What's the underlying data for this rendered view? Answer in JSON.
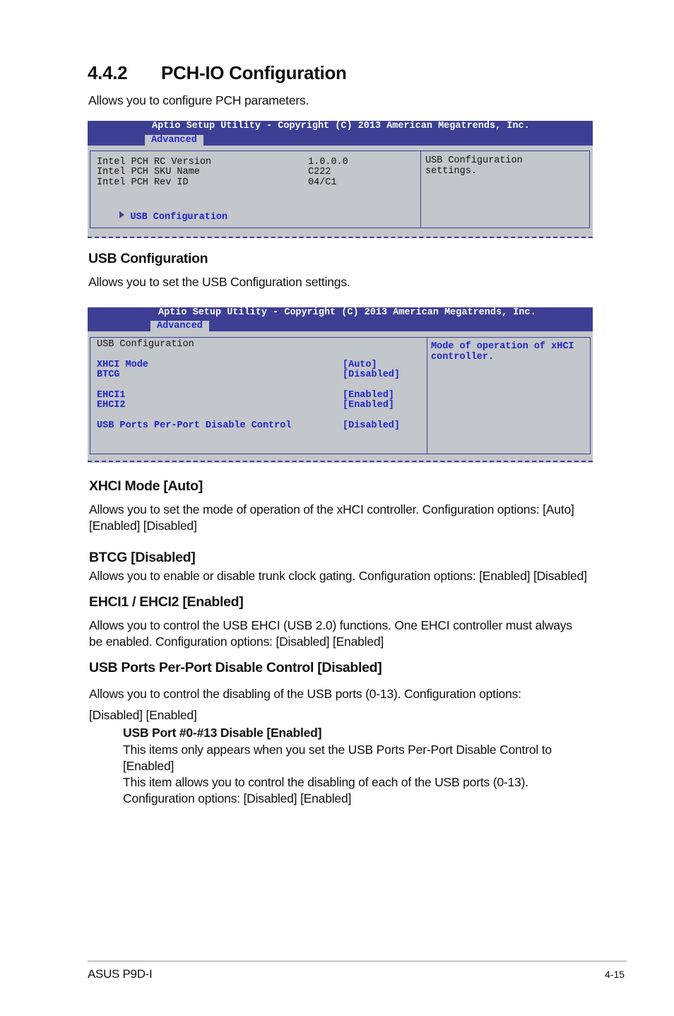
{
  "section": {
    "number": "4.4.2",
    "title": "PCH-IO Configuration",
    "intro": "Allows you to configure PCH parameters."
  },
  "bios1": {
    "title": "Aptio Setup Utility - Copyright (C) 2013 American Megatrends, Inc.",
    "tab": "Advanced",
    "rows": [
      {
        "label": "Intel PCH RC Version",
        "value": "1.0.0.0"
      },
      {
        "label": "Intel PCH SKU Name",
        "value": "C222"
      },
      {
        "label": "Intel PCH Rev ID",
        "value": "04/C1"
      }
    ],
    "submenu": "USB Configuration",
    "help": [
      "USB Configuration",
      "settings."
    ]
  },
  "usb_config": {
    "heading": "USB Configuration",
    "description": "Allows you to set the USB Configuration settings."
  },
  "bios2": {
    "title": "Aptio Setup Utility - Copyright (C) 2013 American Megatrends, Inc.",
    "tab": "Advanced",
    "header": "USB Configuration",
    "items": [
      {
        "label": "XHCI Mode",
        "value": "[Auto]"
      },
      {
        "label": "BTCG",
        "value": "[Disabled]"
      },
      {
        "label": "EHCI1",
        "value": "[Enabled]"
      },
      {
        "label": "EHCI2",
        "value": "[Enabled]"
      },
      {
        "label": "USB Ports Per-Port Disable Control",
        "value": "[Disabled]"
      }
    ],
    "help": [
      "Mode of operation of xHCI",
      "controller."
    ]
  },
  "descriptions": [
    {
      "heading": "XHCI Mode [Auto]",
      "lines": [
        "Allows you to set the mode of operation of the xHCI controller. Configuration options: [Auto]",
        "[Enabled] [Disabled]"
      ]
    },
    {
      "heading": "BTCG [Disabled]",
      "lines": [
        "Allows you to enable or disable trunk clock gating. Configuration options: [Enabled] [Disabled]"
      ]
    },
    {
      "heading": "EHCI1 / EHCI2 [Enabled]",
      "lines": [
        "Allows you to control the USB EHCI (USB 2.0) functions. One EHCI controller must always",
        "be enabled. Configuration options: [Disabled] [Enabled]"
      ]
    },
    {
      "heading": "USB Ports Per-Port Disable Control [Disabled]",
      "lines": [
        "Allows you to control the disabling of the USB ports (0-13). Configuration options:",
        "[Disabled] [Enabled]"
      ]
    }
  ],
  "sub_item": {
    "heading": "USB Port #0-#13 Disable [Enabled]",
    "lines": [
      "This items only appears when you set the USB Ports Per-Port Disable Control to",
      "[Enabled]",
      "This item allows you to control the disabling of each of the USB ports (0-13).",
      "Configuration options: [Disabled] [Enabled]"
    ]
  },
  "footer": {
    "product": "ASUS P9D-I",
    "page": "4-15"
  }
}
